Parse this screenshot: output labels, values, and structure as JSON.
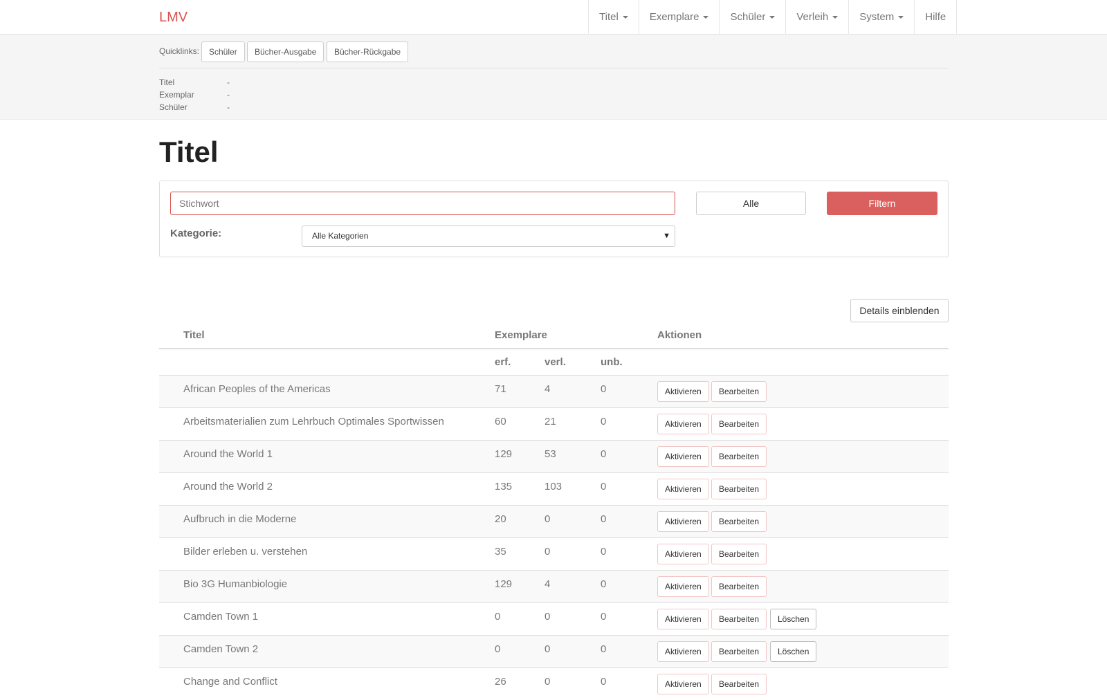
{
  "navbar": {
    "brand": "LMV",
    "items": [
      {
        "label": "Titel",
        "dropdown": true
      },
      {
        "label": "Exemplare",
        "dropdown": true
      },
      {
        "label": "Schüler",
        "dropdown": true
      },
      {
        "label": "Verleih",
        "dropdown": true
      },
      {
        "label": "System",
        "dropdown": true
      },
      {
        "label": "Hilfe",
        "dropdown": false
      }
    ]
  },
  "quicklinks": {
    "label": "Quicklinks:",
    "buttons": [
      "Schüler",
      "Bücher-Ausgabe",
      "Bücher-Rückgabe"
    ]
  },
  "info": [
    {
      "key": "Titel",
      "value": "-"
    },
    {
      "key": "Exemplar",
      "value": "-"
    },
    {
      "key": "Schüler",
      "value": "-"
    }
  ],
  "page": {
    "title": "Titel"
  },
  "filter": {
    "search_placeholder": "Stichwort",
    "search_value": "",
    "all_label": "Alle",
    "filter_label": "Filtern",
    "category_label": "Kategorie:",
    "category_selected": "Alle Kategorien"
  },
  "details_button": "Details einblenden",
  "table": {
    "headers": {
      "title": "Titel",
      "copies": "Exemplare",
      "actions": "Aktionen"
    },
    "subheaders": {
      "recorded": "erf.",
      "lent": "verl.",
      "unusable": "unb."
    },
    "action_labels": {
      "activate": "Aktivieren",
      "edit": "Bearbeiten",
      "delete": "Löschen"
    },
    "rows": [
      {
        "title": "African Peoples of the Americas",
        "erf": "71",
        "verl": "4",
        "unb": "0",
        "deletable": false
      },
      {
        "title": "Arbeitsmaterialien zum Lehrbuch Optimales Sportwissen",
        "erf": "60",
        "verl": "21",
        "unb": "0",
        "deletable": false
      },
      {
        "title": "Around the World 1",
        "erf": "129",
        "verl": "53",
        "unb": "0",
        "deletable": false
      },
      {
        "title": "Around the World 2",
        "erf": "135",
        "verl": "103",
        "unb": "0",
        "deletable": false
      },
      {
        "title": "Aufbruch in die Moderne",
        "erf": "20",
        "verl": "0",
        "unb": "0",
        "deletable": false
      },
      {
        "title": "Bilder erleben u. verstehen",
        "erf": "35",
        "verl": "0",
        "unb": "0",
        "deletable": false
      },
      {
        "title": "Bio 3G Humanbiologie",
        "erf": "129",
        "verl": "4",
        "unb": "0",
        "deletable": false
      },
      {
        "title": "Camden Town 1",
        "erf": "0",
        "verl": "0",
        "unb": "0",
        "deletable": true
      },
      {
        "title": "Camden Town 2",
        "erf": "0",
        "verl": "0",
        "unb": "0",
        "deletable": true
      },
      {
        "title": "Change and Conflict",
        "erf": "26",
        "verl": "0",
        "unb": "0",
        "deletable": false
      }
    ]
  }
}
